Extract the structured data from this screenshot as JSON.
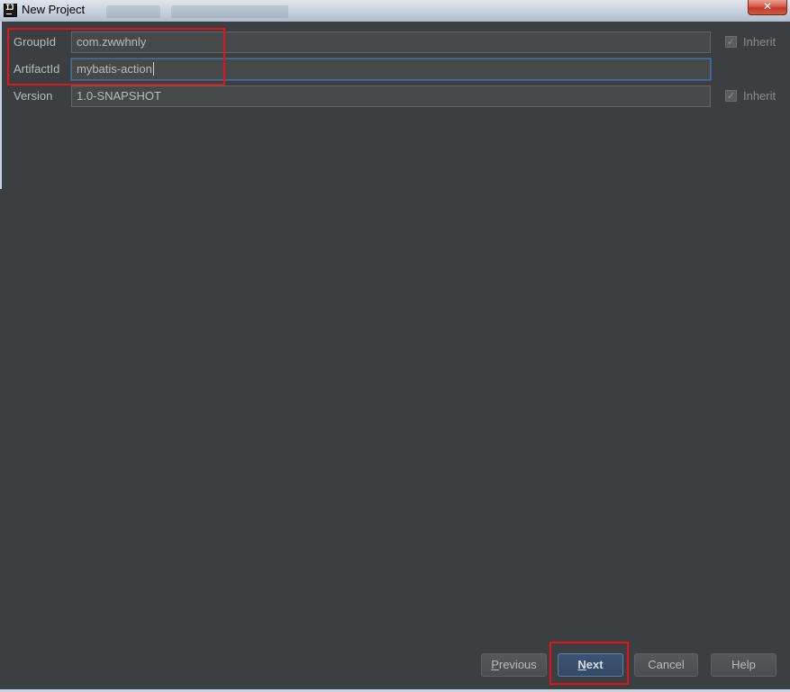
{
  "window": {
    "title": "New Project",
    "close_glyph": "✕",
    "app_icon": "intellij-icon",
    "app_icon_glyph": "IJ"
  },
  "form": {
    "group_id": {
      "label": "GroupId",
      "value": "com.zwwhnly",
      "inherit_label": "Inherit",
      "inherit_checked": true
    },
    "artifact_id": {
      "label": "ArtifactId",
      "value": "mybatis-action"
    },
    "version": {
      "label": "Version",
      "value": "1.0-SNAPSHOT",
      "inherit_label": "Inherit",
      "inherit_checked": true
    }
  },
  "buttons": {
    "previous": {
      "mnemonic": "P",
      "rest": "revious"
    },
    "next": {
      "mnemonic": "N",
      "rest": "ext"
    },
    "cancel": "Cancel",
    "help": "Help"
  },
  "colors": {
    "background": "#3c3f41",
    "highlight": "#e0141a",
    "primary_button": "#3b5473"
  }
}
